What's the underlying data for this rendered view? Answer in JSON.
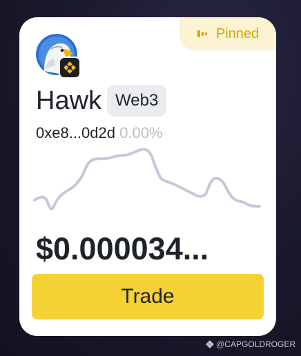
{
  "card": {
    "pinned_label": "Pinned",
    "token_name": "Hawk",
    "tag": "Web3",
    "address": "0xe8...0d2d",
    "change": "0.00%",
    "price": "$0.000034...",
    "trade_label": "Trade",
    "icons": {
      "pin": "pin-icon",
      "avatar": "eagle-avatar",
      "chain": "bnb-chain-icon"
    }
  },
  "watermark": "@CAPGOLDROGER",
  "colors": {
    "accent": "#f5d133",
    "pinned_text": "#d7a600",
    "pinned_bg": "#fbf3d2",
    "sparkline": "#c3c9d6",
    "muted": "#b7bdc6"
  }
}
